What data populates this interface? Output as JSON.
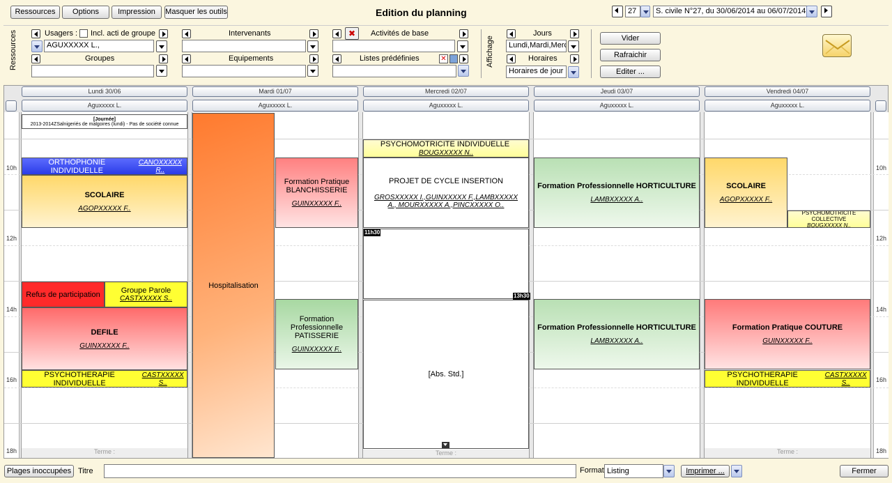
{
  "toolbar": {
    "ressources": "Ressources",
    "options": "Options",
    "impression": "Impression",
    "masquer": "Masquer les outils",
    "title": "Edition du planning",
    "week_num": "27",
    "week_label": "S. civile N°27, du 30/06/2014 au 06/07/2014"
  },
  "filters": {
    "side_label": "Ressources",
    "usagers_label": "Usagers :",
    "incl_label": "Incl. acti de groupe",
    "usagers_value": "AGUXXXXX L.,",
    "groupes_label": "Groupes",
    "groupes_value": "",
    "intervenants_label": "Intervenants",
    "intervenants_value": "",
    "equipements_label": "Equipements",
    "equipements_value": "",
    "activites_label": "Activités de base",
    "activites_value": "",
    "listes_label": "Listes prédéfinies",
    "listes_value": "",
    "affichage_label": "Affichage",
    "jours_label": "Jours",
    "jours_value": "Lundi,Mardi,Merc",
    "horaires_label": "Horaires",
    "horaires_value": "Horaires de jour",
    "vider": "Vider",
    "rafraichir": "Rafraichir",
    "editer": "Editer ..."
  },
  "days": [
    {
      "label": "Lundi 30/06",
      "person": "Aguxxxxx L."
    },
    {
      "label": "Mardi 01/07",
      "person": "Aguxxxxx L."
    },
    {
      "label": "Mercredi 02/07",
      "person": "Aguxxxxx L."
    },
    {
      "label": "Jeudi 03/07",
      "person": "Aguxxxxx L."
    },
    {
      "label": "Vendredi 04/07",
      "person": "Aguxxxxx L."
    }
  ],
  "hours": [
    "10h",
    "12h",
    "14h",
    "16h",
    "18h"
  ],
  "events": {
    "mon_journee_title": "[Journée]",
    "mon_journee_text": "2013-2014ZSalnigeriés de malgoires (lundi) - Pas de société connue",
    "mon_ortho_title": "ORTHOPHONIE INDIVIDUELLE",
    "mon_ortho_person": "CANOXXXXX R..",
    "mon_scolaire_title": "SCOLAIRE",
    "mon_scolaire_person": "AGOPXXXXX F..",
    "mon_refus_title": "Refus de participation",
    "mon_groupe_title": "Groupe Parole",
    "mon_groupe_person": "CASTXXXXX S..",
    "mon_defile_title": "DEFILE",
    "mon_defile_person": "GUINXXXXX F..",
    "mon_psycho_title": "PSYCHOTHERAPIE INDIVIDUELLE",
    "mon_psycho_person": "CASTXXXXX S..",
    "mon_footer": "Terme :",
    "tue_hosp_title": "Hospitalisation",
    "tue_blanch_title": "Formation Pratique BLANCHISSERIE",
    "tue_blanch_person": "GUINXXXXX F..",
    "tue_patis_title": "Formation Professionnelle PATISSERIE",
    "tue_patis_person": "GUINXXXXX F..",
    "wed_psychomot_title": "PSYCHOMOTRICITE INDIVIDUELLE",
    "wed_psychomot_person": "BOUGXXXXX N..",
    "wed_projet_title": "PROJET DE CYCLE INSERTION",
    "wed_projet_person": "GROSXXXXX I.,GUINXXXXX F.,LAMBXXXXX A., MOURXXXXX A.,PINCXXXXX O..",
    "wed_time_start": "11h30",
    "wed_time_end": "13h30",
    "wed_abs_title": "[Abs. Std.]",
    "wed_footer": "Terme :",
    "thu_horti1_title": "Formation Professionnelle HORTICULTURE",
    "thu_horti1_person": "LAMBXXXXX A..",
    "thu_horti2_title": "Formation Professionnelle HORTICULTURE",
    "thu_horti2_person": "LAMBXXXXX A..",
    "fri_scolaire_title": "SCOLAIRE",
    "fri_scolaire_person": "AGOPXXXXX F..",
    "fri_psychomot_title": "PSYCHOMOTRICITE COLLECTIVE",
    "fri_psychomot_person": "BOUGXXXXX N..",
    "fri_couture_title": "Formation Pratique COUTURE",
    "fri_couture_person": "GUINXXXXX F..",
    "fri_psycho_title": "PSYCHOTHERAPIE INDIVIDUELLE",
    "fri_psycho_person": "CASTXXXXX S..",
    "fri_footer": "Terme :"
  },
  "bottom": {
    "plages": "Plages inoccupées",
    "titre_label": "Titre",
    "titre_value": "",
    "format_label": "Format",
    "format_value": "Listing",
    "imprimer": "Imprimer ...",
    "fermer": "Fermer"
  },
  "colors": {
    "accent": "#fbf6df",
    "orange": "#ff8a3d",
    "blue": "#3346ff",
    "red": "#ff3030",
    "yellow": "#ffff33",
    "green": "#c6e6c3",
    "pink": "#ffb3b3"
  }
}
